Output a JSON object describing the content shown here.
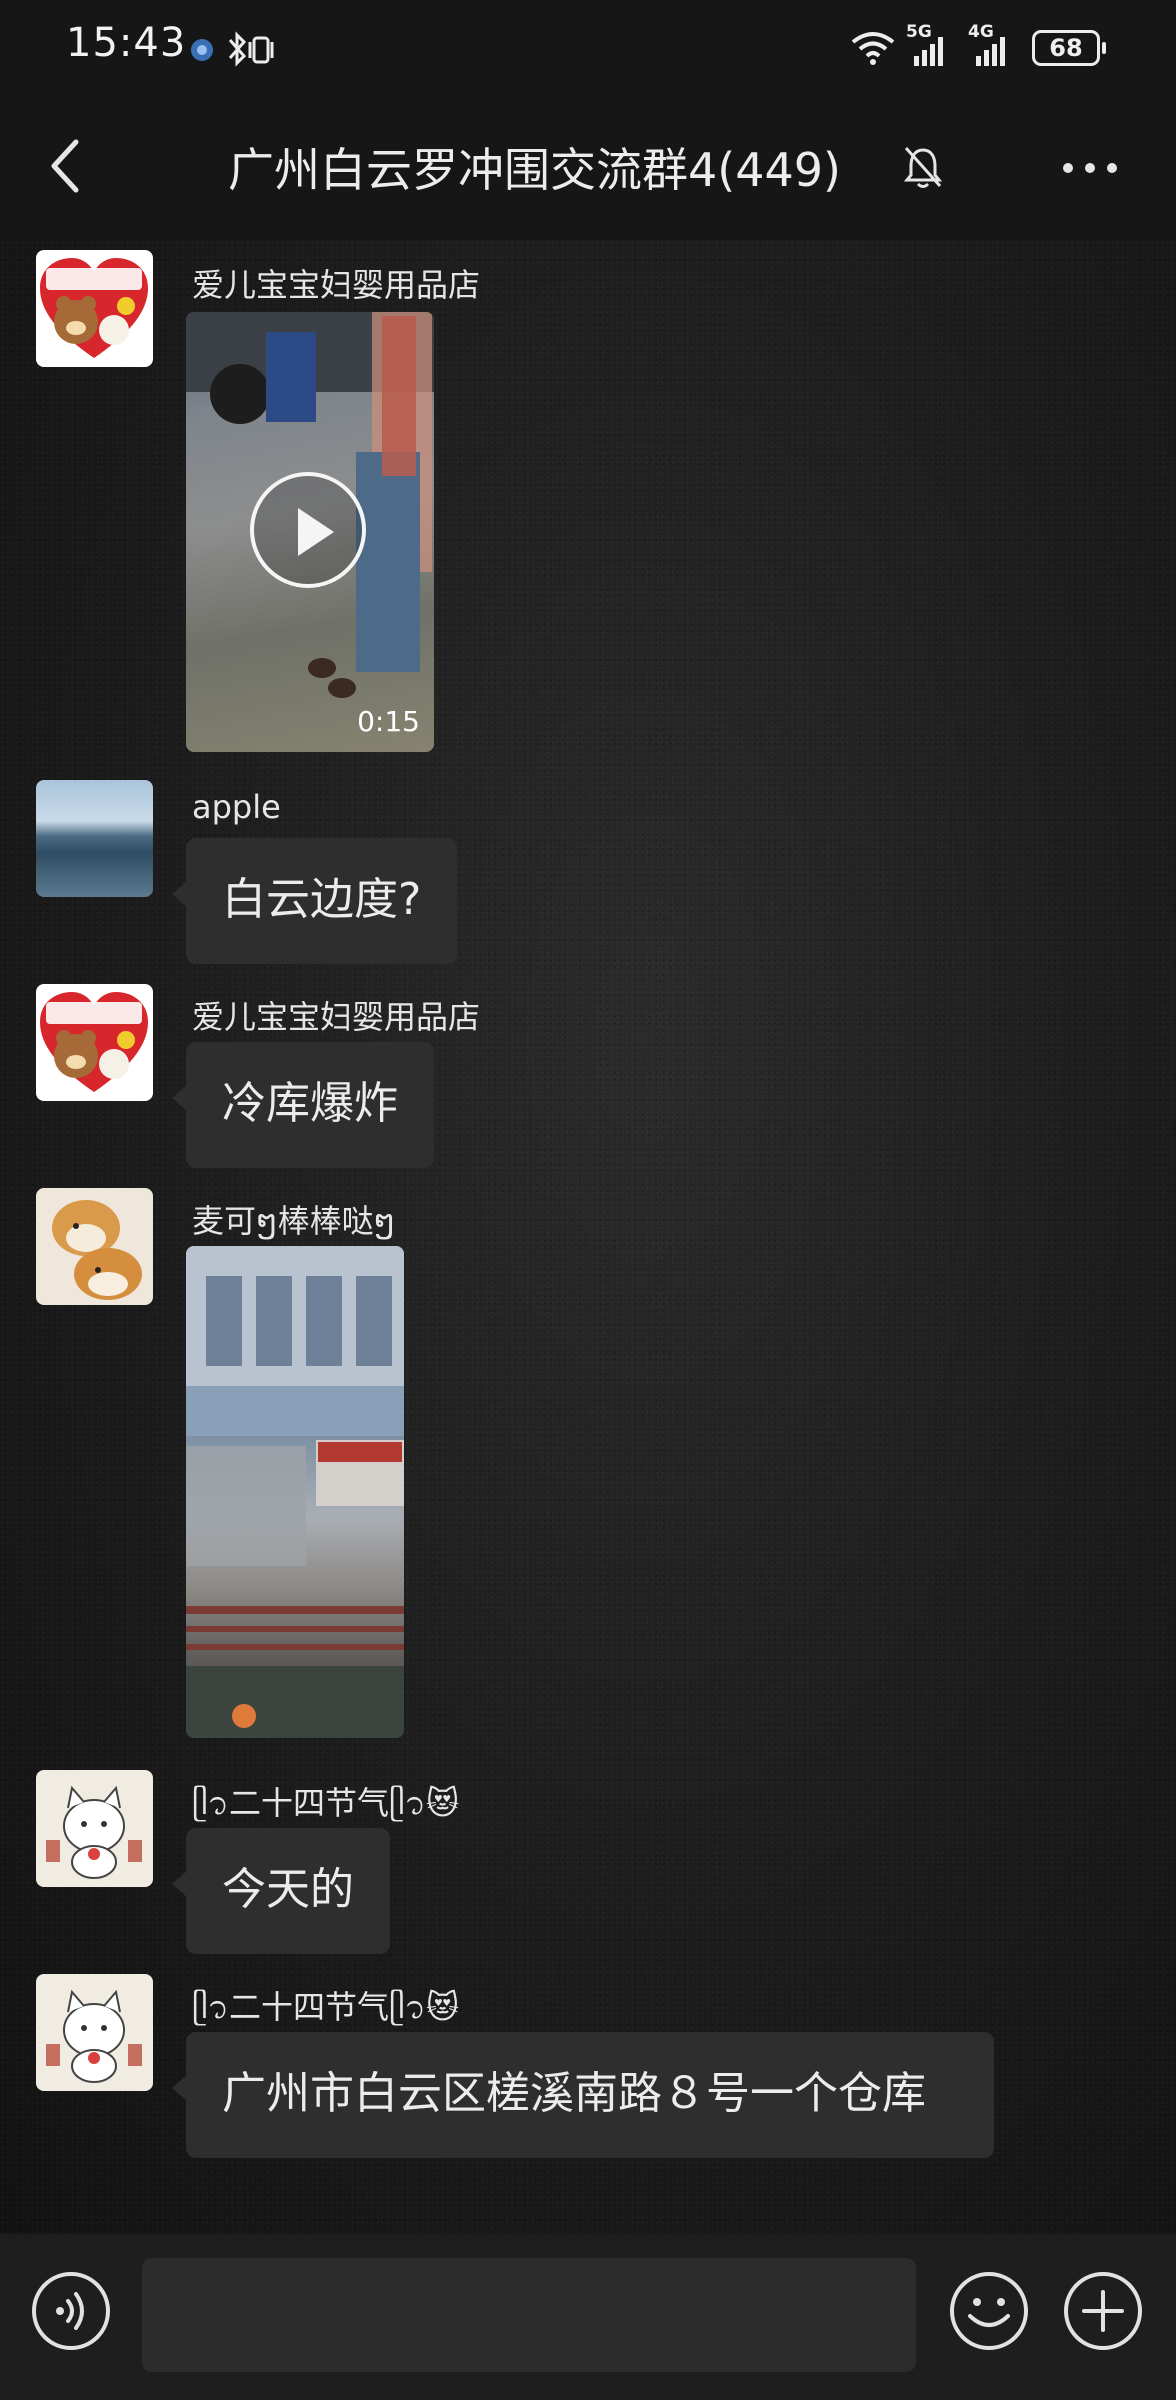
{
  "status_bar": {
    "time": "15:43",
    "network_5g": "5G",
    "network_4g": "4G",
    "battery": "68"
  },
  "header": {
    "title": "广州白云罗冲围交流群4(449)"
  },
  "messages": [
    {
      "sender": "爱儿宝宝妇婴用品店",
      "type": "video",
      "duration": "0:15"
    },
    {
      "sender": "apple",
      "type": "text",
      "text": "白云边度?"
    },
    {
      "sender": "爱儿宝宝妇婴用品店",
      "type": "text",
      "text": "冷库爆炸"
    },
    {
      "sender": "麦可ໆ棒棒哒ໆ",
      "type": "video"
    },
    {
      "sender": "ᥫ᭡二十四节气ᥫ᭡😻",
      "type": "text",
      "text": "今天的"
    },
    {
      "sender": "ᥫ᭡二十四节气ᥫ᭡😻",
      "type": "text",
      "text": "广州市白云区槎溪南路８号一个仓库"
    }
  ],
  "input": {
    "value": "",
    "placeholder": ""
  },
  "icons": {
    "back": "chevron-left-icon",
    "mute": "bell-off-icon",
    "more": "more-dots-icon",
    "voice": "voice-icon",
    "emoji": "emoji-icon",
    "plus": "plus-icon"
  },
  "colors": {
    "background": "#141414",
    "bubble": "#2e2e2e",
    "text": "#ececec"
  }
}
